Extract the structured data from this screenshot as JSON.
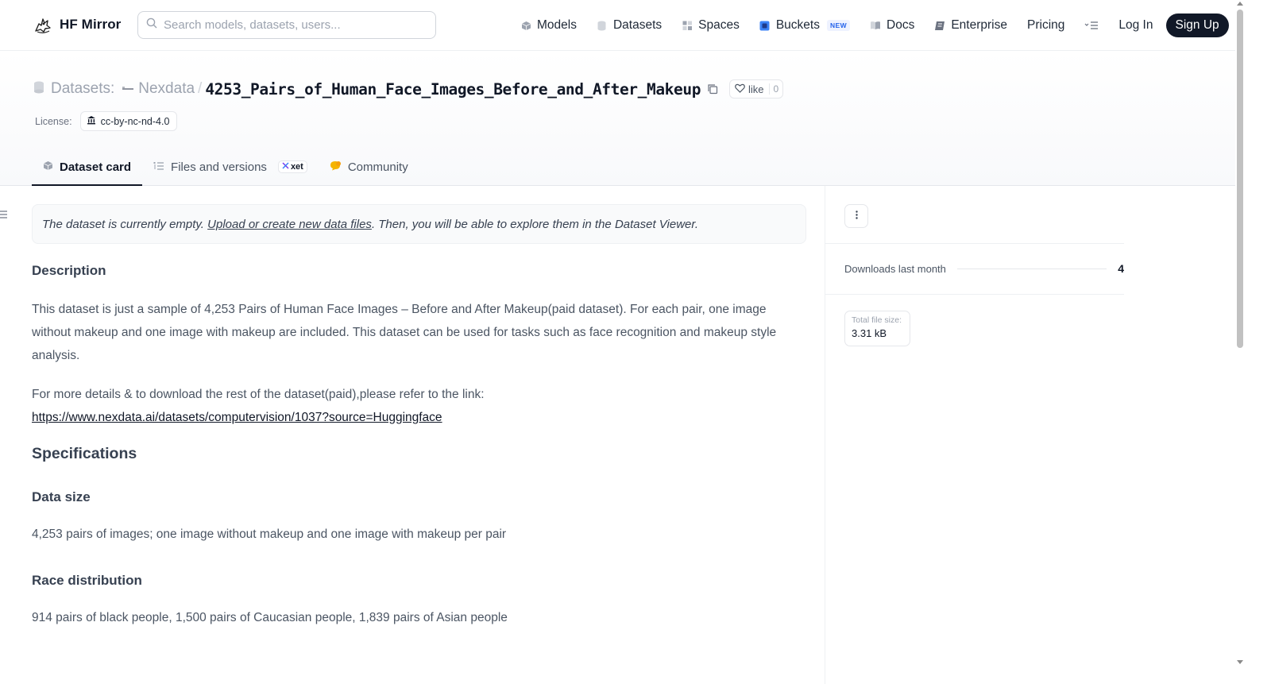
{
  "brand": {
    "name": "HF Mirror",
    "logo_icon": "hf-mirror-logo-icon"
  },
  "search": {
    "placeholder": "Search models, datasets, users..."
  },
  "nav": {
    "items": [
      {
        "label": "Models",
        "icon": "cube-icon"
      },
      {
        "label": "Datasets",
        "icon": "database-icon"
      },
      {
        "label": "Spaces",
        "icon": "grid-icon"
      },
      {
        "label": "Buckets",
        "icon": "bucket-icon",
        "badge": "NEW"
      },
      {
        "label": "Docs",
        "icon": "book-icon"
      },
      {
        "label": "Enterprise",
        "icon": "enterprise-icon"
      },
      {
        "label": "Pricing"
      }
    ],
    "more_icon": "menu-more-icon",
    "login": "Log In",
    "signup": "Sign Up"
  },
  "header": {
    "type_label": "Datasets:",
    "org": "Nexdata",
    "separator": "/",
    "title": "4253_Pairs_of_Human_Face_Images_Before_and_After_Makeup",
    "like_label": "like",
    "like_count": "0",
    "license_label": "License:",
    "license_value": "cc-by-nc-nd-4.0"
  },
  "tabs": [
    {
      "label": "Dataset card",
      "icon": "cube-icon",
      "active": true
    },
    {
      "label": "Files and versions",
      "icon": "files-icon",
      "badge": "xet"
    },
    {
      "label": "Community",
      "icon": "community-icon"
    }
  ],
  "notice": {
    "before": "The dataset is currently empty. ",
    "link": "Upload or create new data files",
    "after": ". Then, you will be able to explore them in the Dataset Viewer."
  },
  "content": {
    "description_title": "Description",
    "description_text": "This dataset is just a sample of 4,253 Pairs of Human Face Images – Before and After Makeup(paid dataset). For each pair, one image without makeup and one image with makeup are included. This dataset can be used for tasks such as face recognition and makeup style analysis.",
    "details_text": "For more details & to download the rest of the dataset(paid),please refer to the link:",
    "details_link": "https://www.nexdata.ai/datasets/computervision/1037?source=Huggingface",
    "specifications_title": "Specifications",
    "data_size_title": "Data size",
    "data_size_text": "4,253 pairs of images; one image without makeup and one image with makeup per pair",
    "race_title": "Race distribution",
    "race_text": "914 pairs of black people, 1,500 pairs of Caucasian people, 1,839 pairs of Asian people"
  },
  "sidebar": {
    "downloads_label": "Downloads last month",
    "downloads_value": "4",
    "file_size_label": "Total file size:",
    "file_size_value": "3.31 kB"
  },
  "colors": {
    "primary_text": "#111827",
    "muted_text": "#9ca3af",
    "signup_bg": "#111827",
    "new_badge": "#2563eb",
    "community_icon": "#f4b400"
  }
}
